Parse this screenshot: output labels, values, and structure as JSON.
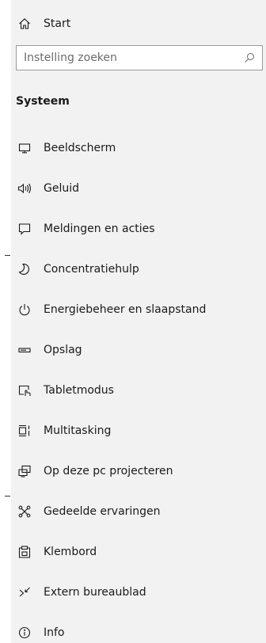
{
  "start_label": "Start",
  "search": {
    "placeholder": "Instelling zoeken"
  },
  "section_title": "Systeem",
  "nav_items": [
    {
      "label": "Beeldscherm",
      "icon": "monitor-icon"
    },
    {
      "label": "Geluid",
      "icon": "speaker-icon"
    },
    {
      "label": "Meldingen en acties",
      "icon": "notification-icon"
    },
    {
      "label": "Concentratiehulp",
      "icon": "moon-icon"
    },
    {
      "label": "Energiebeheer en slaapstand",
      "icon": "power-icon"
    },
    {
      "label": "Opslag",
      "icon": "storage-icon"
    },
    {
      "label": "Tabletmodus",
      "icon": "tablet-mode-icon"
    },
    {
      "label": "Multitasking",
      "icon": "multitasking-icon"
    },
    {
      "label": "Op deze pc projecteren",
      "icon": "project-icon"
    },
    {
      "label": "Gedeelde ervaringen",
      "icon": "shared-experiences-icon"
    },
    {
      "label": "Klembord",
      "icon": "clipboard-icon"
    },
    {
      "label": "Extern bureaublad",
      "icon": "remote-desktop-icon"
    },
    {
      "label": "Info",
      "icon": "info-icon"
    }
  ],
  "colors": {
    "sidebar_background": "#f2f2f2",
    "text": "#1a1a1a",
    "top_accent": "#a9c6ea"
  }
}
